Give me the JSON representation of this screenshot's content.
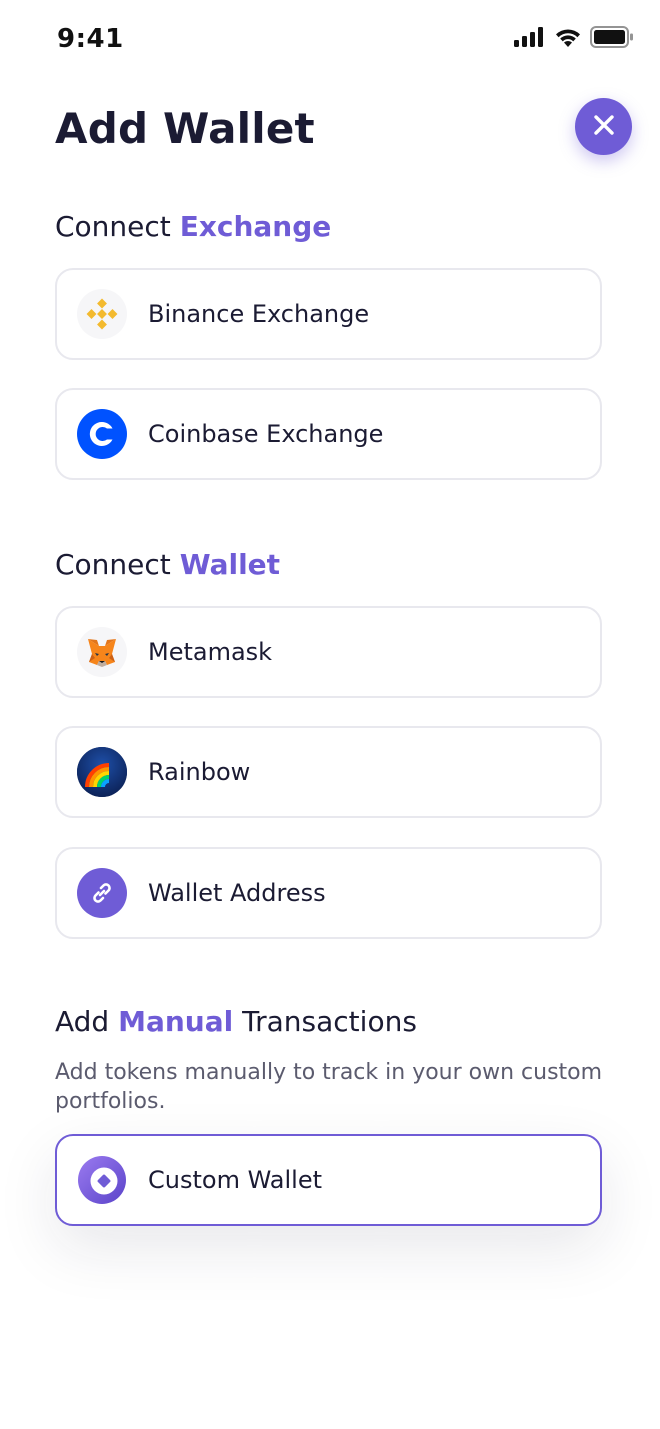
{
  "status_bar": {
    "time": "9:41"
  },
  "header": {
    "title": "Add Wallet"
  },
  "colors": {
    "accent": "#6f5cd6",
    "text": "#1b1b33",
    "muted": "#5b5b6e",
    "card_border": "#e8e8ee"
  },
  "sections": {
    "exchange": {
      "prefix": "Connect ",
      "accent": "Exchange",
      "items": [
        {
          "label": "Binance Exchange",
          "icon": "binance-icon"
        },
        {
          "label": "Coinbase Exchange",
          "icon": "coinbase-icon"
        }
      ]
    },
    "wallet": {
      "prefix": "Connect ",
      "accent": "Wallet",
      "items": [
        {
          "label": "Metamask",
          "icon": "metamask-icon"
        },
        {
          "label": "Rainbow",
          "icon": "rainbow-icon"
        },
        {
          "label": "Wallet Address",
          "icon": "link-icon"
        }
      ]
    },
    "manual": {
      "prefix": "Add ",
      "accent": "Manual",
      "suffix": " Transactions",
      "description": "Add tokens manually to track in your own custom portfolios.",
      "items": [
        {
          "label": "Custom Wallet",
          "icon": "custom-wallet-icon"
        }
      ]
    }
  }
}
